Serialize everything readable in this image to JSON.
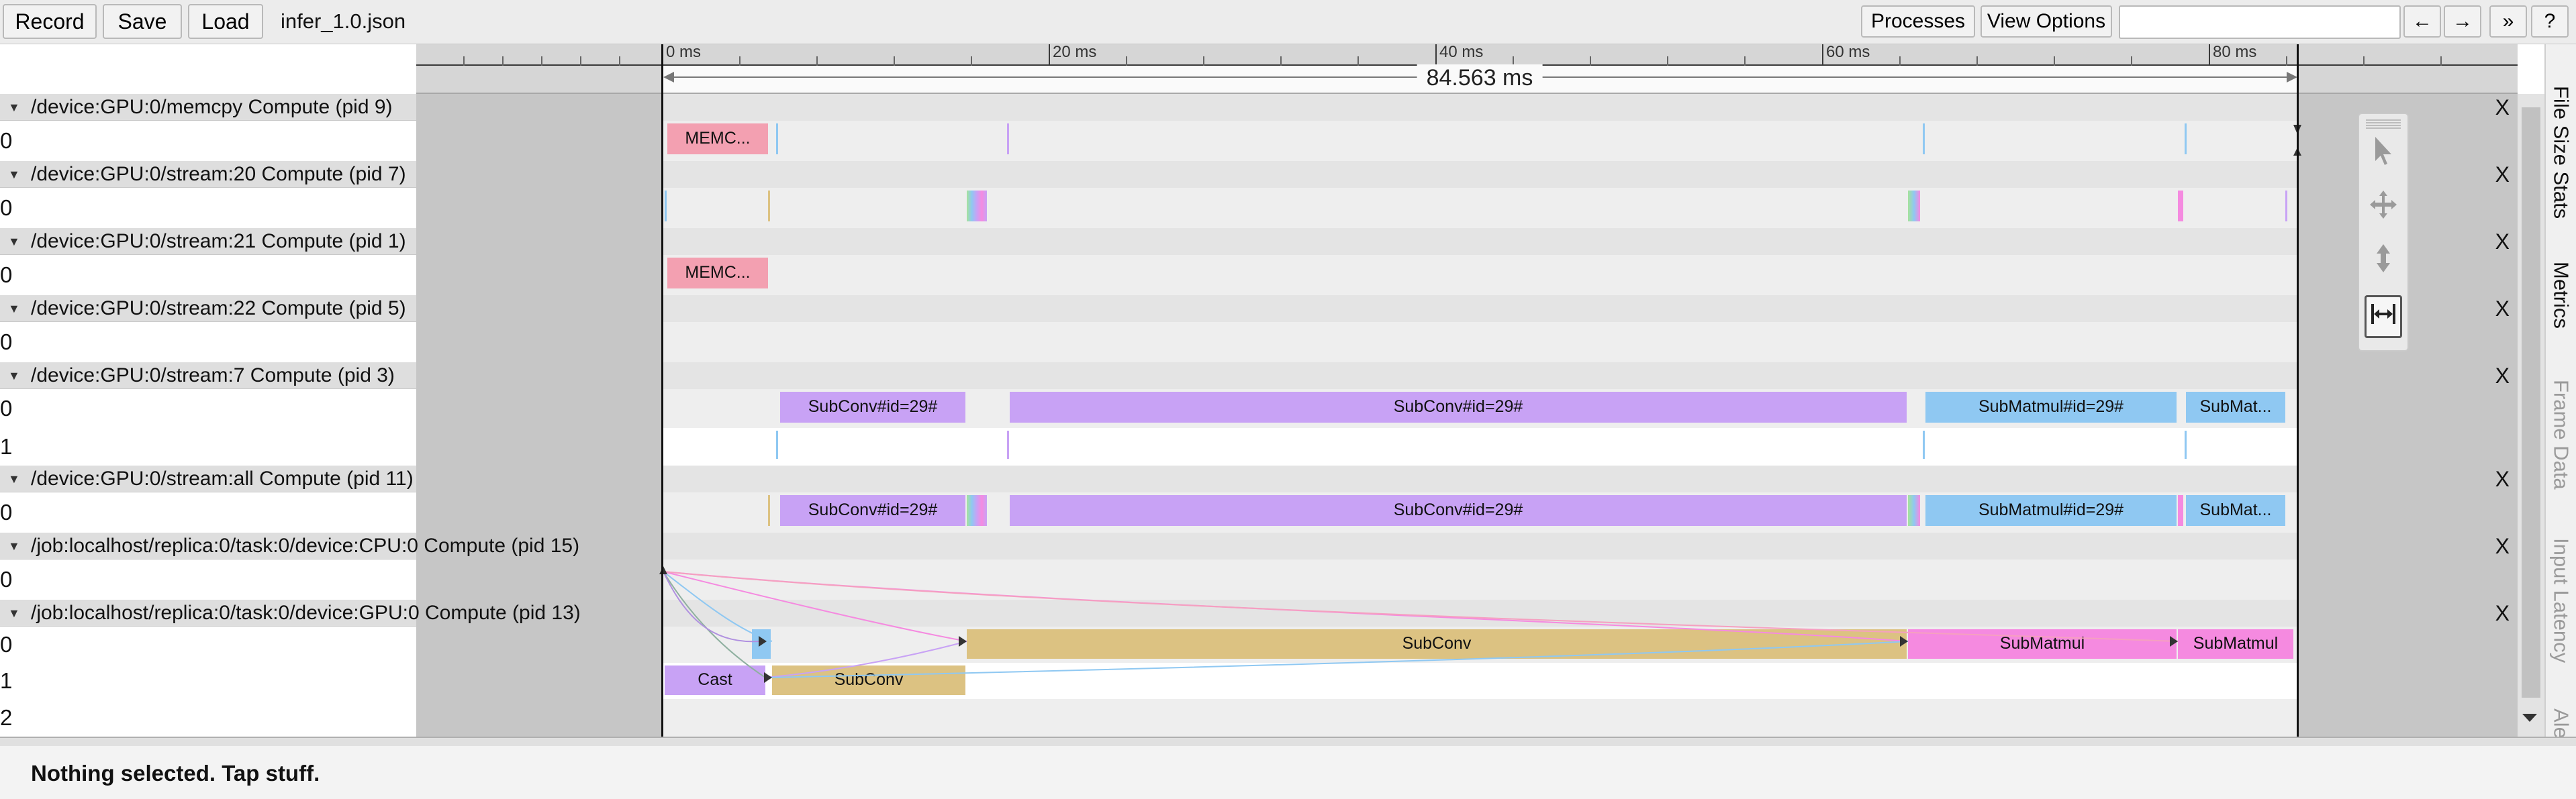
{
  "toolbar": {
    "record_label": "Record",
    "save_label": "Save",
    "load_label": "Load",
    "filename": "infer_1.0.json",
    "processes_label": "Processes",
    "view_options_label": "View Options",
    "search_placeholder": "",
    "prev_label": "←",
    "next_label": "→",
    "expand_label": "»",
    "help_label": "?"
  },
  "ruler": {
    "ticks": [
      "0 ms",
      "20 ms",
      "40 ms",
      "60 ms",
      "80 ms"
    ],
    "duration_label": "84.563 ms"
  },
  "processes": [
    {
      "title": "/device:GPU:0/memcpy Compute (pid 9)",
      "threads": [
        {
          "label": "0",
          "slices": [
            {
              "name": "MEMC...",
              "color": "#f3a0b1"
            }
          ]
        }
      ]
    },
    {
      "title": "/device:GPU:0/stream:20 Compute (pid 7)",
      "threads": [
        {
          "label": "0",
          "slices": []
        }
      ]
    },
    {
      "title": "/device:GPU:0/stream:21 Compute (pid 1)",
      "threads": [
        {
          "label": "0",
          "slices": [
            {
              "name": "MEMC...",
              "color": "#f3a0b1"
            }
          ]
        }
      ]
    },
    {
      "title": "/device:GPU:0/stream:22 Compute (pid 5)",
      "threads": [
        {
          "label": "0",
          "slices": []
        }
      ]
    },
    {
      "title": "/device:GPU:0/stream:7 Compute (pid 3)",
      "threads": [
        {
          "label": "0",
          "slices": [
            {
              "name": "SubConv#id=29#",
              "color": "#c8a2f5"
            },
            {
              "name": "SubConv#id=29#",
              "color": "#c8a2f5"
            },
            {
              "name": "SubMatmul#id=29#",
              "color": "#8fc8f2"
            },
            {
              "name": "SubMat...",
              "color": "#8fc8f2"
            }
          ]
        },
        {
          "label": "1",
          "slices": []
        }
      ]
    },
    {
      "title": "/device:GPU:0/stream:all Compute (pid 11)",
      "threads": [
        {
          "label": "0",
          "slices": [
            {
              "name": "SubConv#id=29#",
              "color": "#c8a2f5"
            },
            {
              "name": "SubConv#id=29#",
              "color": "#c8a2f5"
            },
            {
              "name": "SubMatmul#id=29#",
              "color": "#8fc8f2"
            },
            {
              "name": "SubMat...",
              "color": "#8fc8f2"
            }
          ]
        }
      ]
    },
    {
      "title": "/job:localhost/replica:0/task:0/device:CPU:0 Compute (pid 15)",
      "threads": [
        {
          "label": "0",
          "slices": []
        }
      ]
    },
    {
      "title": "/job:localhost/replica:0/task:0/device:GPU:0 Compute (pid 13)",
      "threads": [
        {
          "label": "0",
          "slices": [
            {
              "name": "SubConv",
              "color": "#dcc282"
            },
            {
              "name": "SubMatmul",
              "color": "#f58ae0"
            },
            {
              "name": "SubMatmul",
              "color": "#f58ae0"
            }
          ]
        },
        {
          "label": "1",
          "slices": [
            {
              "name": "Cast",
              "color": "#c8a2f5"
            },
            {
              "name": "SubConv",
              "color": "#dcc282"
            }
          ]
        },
        {
          "label": "2",
          "slices": []
        }
      ]
    }
  ],
  "close_label": "X",
  "side_tabs": [
    "File Size Stats",
    "Metrics",
    "Frame Data",
    "Input Latency",
    "Ale"
  ],
  "status": "Nothing selected. Tap stuff."
}
